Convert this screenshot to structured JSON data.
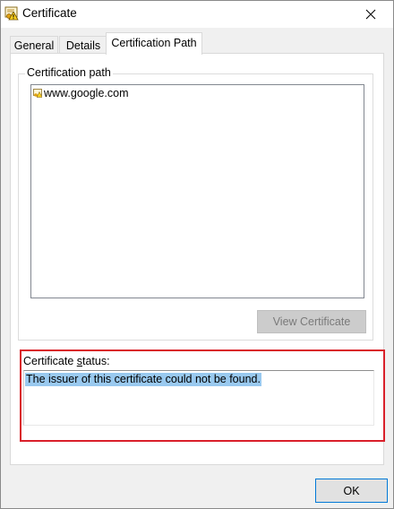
{
  "window": {
    "title": "Certificate"
  },
  "tabs": [
    {
      "label": "General"
    },
    {
      "label": "Details"
    },
    {
      "label": "Certification Path"
    }
  ],
  "certification_path": {
    "group_label": "Certification path",
    "items": [
      {
        "label": "www.google.com",
        "icon": "certificate-warning-icon"
      }
    ],
    "view_button_label": "View Certificate"
  },
  "status": {
    "label_prefix": "Certificate ",
    "label_underlined": "s",
    "label_suffix": "tatus:",
    "text": "The issuer of this certificate could not be found."
  },
  "footer": {
    "ok_label": "OK"
  },
  "colors": {
    "highlight_frame": "#d9202a",
    "selection": "#99c9ef",
    "focus_border": "#0078d7"
  }
}
